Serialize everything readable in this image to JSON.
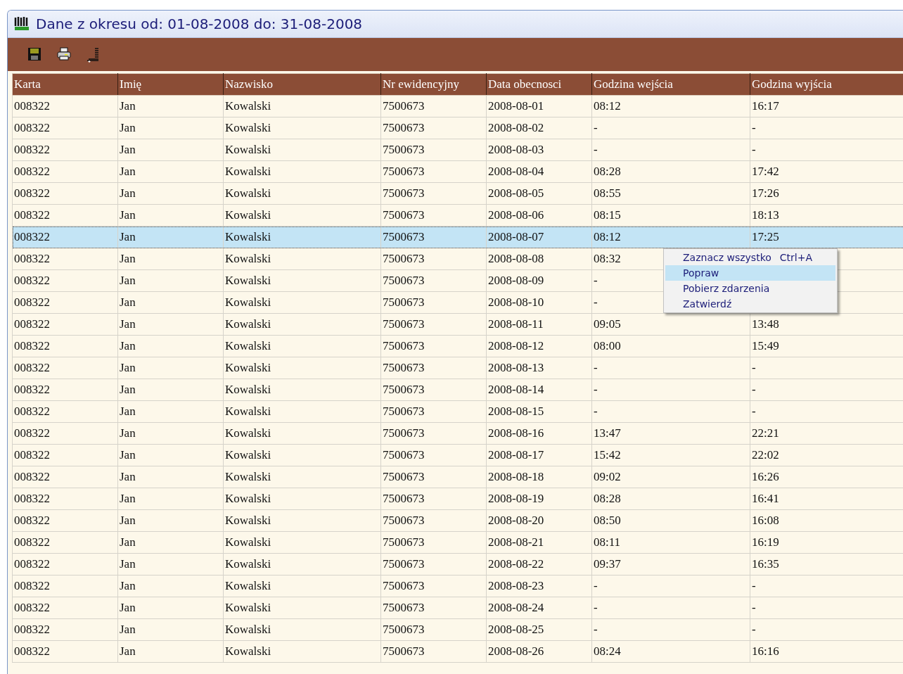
{
  "window": {
    "title": "Dane z okresu od: 01-08-2008 do: 31-08-2008"
  },
  "toolbar": [
    {
      "kind": "save"
    },
    {
      "kind": "print"
    },
    {
      "kind": "sort"
    }
  ],
  "table": {
    "columns": [
      "Karta",
      "Imię",
      "Nazwisko",
      "Nr ewidencyjny",
      "Data obecnosci",
      "Godzina wejścia",
      "Godzina wyjścia"
    ],
    "rows": [
      {
        "selected": false,
        "cells": [
          "008322",
          "Jan",
          "Kowalski",
          "7500673",
          "2008-08-01",
          "08:12",
          "16:17"
        ]
      },
      {
        "selected": false,
        "cells": [
          "008322",
          "Jan",
          "Kowalski",
          "7500673",
          "2008-08-02",
          "-",
          "-"
        ]
      },
      {
        "selected": false,
        "cells": [
          "008322",
          "Jan",
          "Kowalski",
          "7500673",
          "2008-08-03",
          "-",
          "-"
        ]
      },
      {
        "selected": false,
        "cells": [
          "008322",
          "Jan",
          "Kowalski",
          "7500673",
          "2008-08-04",
          "08:28",
          "17:42"
        ]
      },
      {
        "selected": false,
        "cells": [
          "008322",
          "Jan",
          "Kowalski",
          "7500673",
          "2008-08-05",
          "08:55",
          "17:26"
        ]
      },
      {
        "selected": false,
        "cells": [
          "008322",
          "Jan",
          "Kowalski",
          "7500673",
          "2008-08-06",
          "08:15",
          "18:13"
        ]
      },
      {
        "selected": true,
        "cells": [
          "008322",
          "Jan",
          "Kowalski",
          "7500673",
          "2008-08-07",
          "08:12",
          "17:25"
        ]
      },
      {
        "selected": false,
        "cells": [
          "008322",
          "Jan",
          "Kowalski",
          "7500673",
          "2008-08-08",
          "08:32"
        ]
      },
      {
        "selected": false,
        "cells": [
          "008322",
          "Jan",
          "Kowalski",
          "7500673",
          "2008-08-09",
          "-"
        ]
      },
      {
        "selected": false,
        "cells": [
          "008322",
          "Jan",
          "Kowalski",
          "7500673",
          "2008-08-10",
          "-"
        ]
      },
      {
        "selected": false,
        "cells": [
          "008322",
          "Jan",
          "Kowalski",
          "7500673",
          "2008-08-11",
          "09:05",
          "13:48"
        ]
      },
      {
        "selected": false,
        "cells": [
          "008322",
          "Jan",
          "Kowalski",
          "7500673",
          "2008-08-12",
          "08:00",
          "15:49"
        ]
      },
      {
        "selected": false,
        "cells": [
          "008322",
          "Jan",
          "Kowalski",
          "7500673",
          "2008-08-13",
          "-",
          "-"
        ]
      },
      {
        "selected": false,
        "cells": [
          "008322",
          "Jan",
          "Kowalski",
          "7500673",
          "2008-08-14",
          "-",
          "-"
        ]
      },
      {
        "selected": false,
        "cells": [
          "008322",
          "Jan",
          "Kowalski",
          "7500673",
          "2008-08-15",
          "-",
          "-"
        ]
      },
      {
        "selected": false,
        "cells": [
          "008322",
          "Jan",
          "Kowalski",
          "7500673",
          "2008-08-16",
          "13:47",
          "22:21"
        ]
      },
      {
        "selected": false,
        "cells": [
          "008322",
          "Jan",
          "Kowalski",
          "7500673",
          "2008-08-17",
          "15:42",
          "22:02"
        ]
      },
      {
        "selected": false,
        "cells": [
          "008322",
          "Jan",
          "Kowalski",
          "7500673",
          "2008-08-18",
          "09:02",
          "16:26"
        ]
      },
      {
        "selected": false,
        "cells": [
          "008322",
          "Jan",
          "Kowalski",
          "7500673",
          "2008-08-19",
          "08:28",
          "16:41"
        ]
      },
      {
        "selected": false,
        "cells": [
          "008322",
          "Jan",
          "Kowalski",
          "7500673",
          "2008-08-20",
          "08:50",
          "16:08"
        ]
      },
      {
        "selected": false,
        "cells": [
          "008322",
          "Jan",
          "Kowalski",
          "7500673",
          "2008-08-21",
          "08:11",
          "16:19"
        ]
      },
      {
        "selected": false,
        "cells": [
          "008322",
          "Jan",
          "Kowalski",
          "7500673",
          "2008-08-22",
          "09:37",
          "16:35"
        ]
      },
      {
        "selected": false,
        "cells": [
          "008322",
          "Jan",
          "Kowalski",
          "7500673",
          "2008-08-23",
          "-",
          "-"
        ]
      },
      {
        "selected": false,
        "cells": [
          "008322",
          "Jan",
          "Kowalski",
          "7500673",
          "2008-08-24",
          "-",
          "-"
        ]
      },
      {
        "selected": false,
        "cells": [
          "008322",
          "Jan",
          "Kowalski",
          "7500673",
          "2008-08-25",
          "-",
          "-"
        ]
      },
      {
        "selected": false,
        "cells": [
          "008322",
          "Jan",
          "Kowalski",
          "7500673",
          "2008-08-26",
          "08:24",
          "16:16"
        ]
      }
    ]
  },
  "context_menu": {
    "items": [
      {
        "label": "Zaznacz wszystko",
        "shortcut": "Ctrl+A",
        "selected": false
      },
      {
        "label": "Popraw",
        "selected": true
      },
      {
        "label": "Pobierz zdarzenia",
        "selected": false
      },
      {
        "label": "Zatwierdź",
        "selected": false
      }
    ]
  }
}
